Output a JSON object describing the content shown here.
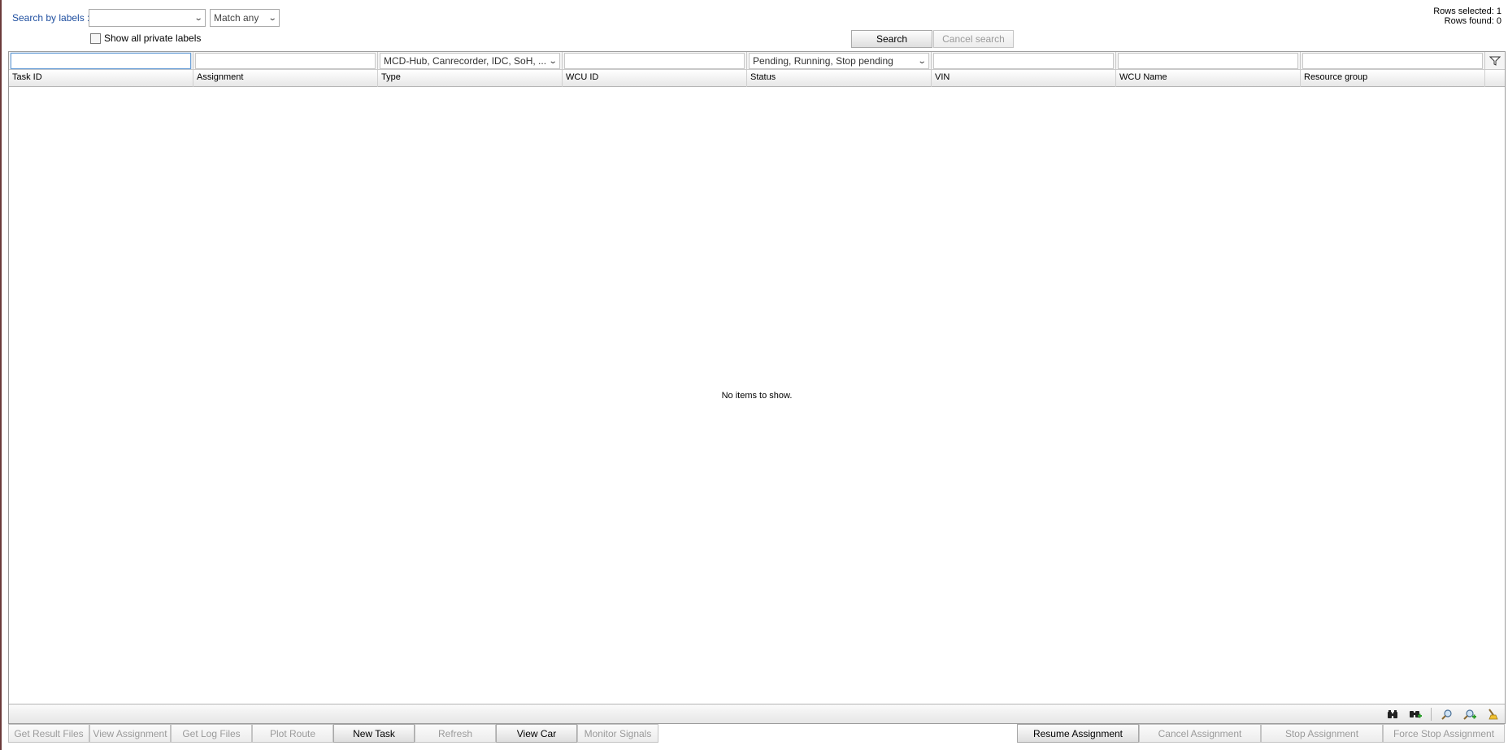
{
  "search": {
    "label": "Search by labels :",
    "labels_value": "",
    "match_value": "Match any",
    "show_private_label": "Show all private labels",
    "search_button": "Search",
    "cancel_button": "Cancel search"
  },
  "rows": {
    "selected": "Rows selected: 1",
    "found": "Rows found: 0"
  },
  "grid": {
    "filters": {
      "type": "MCD-Hub, Canrecorder, IDC, SoH, ...",
      "status": "Pending, Running, Stop pending"
    },
    "columns": [
      "Task ID",
      "Assignment",
      "Type",
      "WCU ID",
      "Status",
      "VIN",
      "WCU Name",
      "Resource group"
    ],
    "empty_message": "No items to show."
  },
  "bottom_buttons": [
    "Get Result Files",
    "View Assignment",
    "Get Log Files",
    "Plot Route",
    "New Task",
    "Refresh",
    "View Car",
    "Monitor Signals"
  ],
  "bottom_buttons_enabled": [
    false,
    false,
    false,
    false,
    true,
    false,
    true,
    false
  ],
  "right_buttons": [
    "Resume Assignment",
    "Cancel Assignment",
    "Stop Assignment",
    "Force Stop Assignment"
  ],
  "right_buttons_enabled": [
    true,
    false,
    false,
    false
  ],
  "footer_icons": [
    "binoculars-icon",
    "binoculars-add-icon",
    "zoom-icon",
    "zoom-add-icon",
    "clear-filter-icon"
  ]
}
